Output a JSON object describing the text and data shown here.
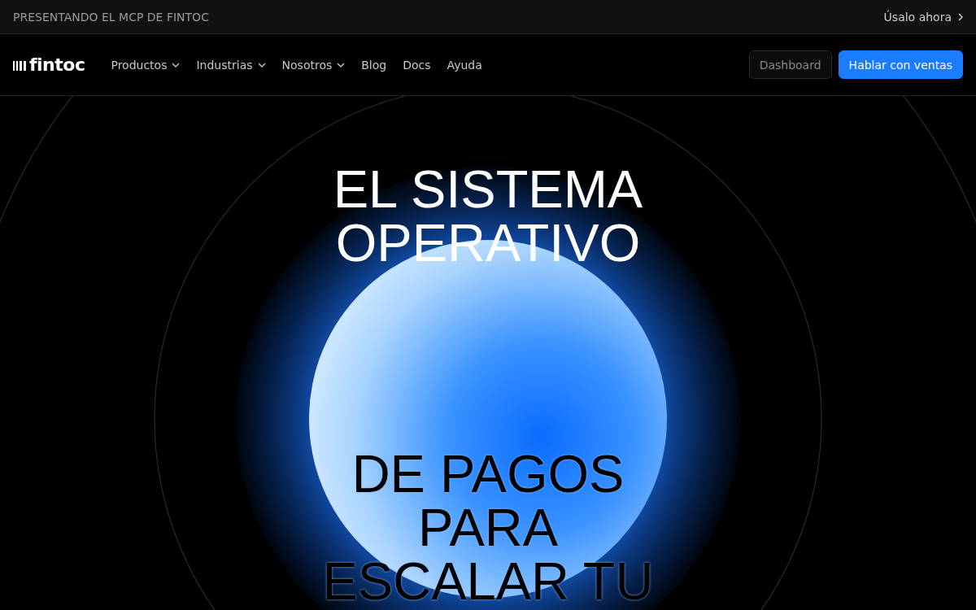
{
  "announcement": {
    "text": "PRESENTANDO EL MCP DE FINTOC",
    "link": "Úsalo ahora"
  },
  "nav": {
    "logo": "fintoc",
    "items": [
      {
        "label": "Productos",
        "kind": "dropdown"
      },
      {
        "label": "Industrias",
        "kind": "dropdown"
      },
      {
        "label": "Nosotros",
        "kind": "dropdown"
      },
      {
        "label": "Blog",
        "kind": "link"
      },
      {
        "label": "Docs",
        "kind": "link"
      },
      {
        "label": "Ayuda",
        "kind": "link"
      }
    ],
    "buttons": [
      {
        "label": "Dashboard",
        "kind": "secondary"
      },
      {
        "label": "Hablar con ventas",
        "kind": "primary"
      }
    ]
  },
  "hero": {
    "headline": [
      {
        "text": "EL SISTEMA",
        "kind": "light"
      },
      {
        "text": "OPERATIVO",
        "kind": "light"
      },
      {
        "text": "DE PAGOS",
        "kind": "dark"
      },
      {
        "text": "PARA",
        "kind": "dark"
      },
      {
        "text": "ESCALAR TU",
        "kind": "dark"
      }
    ]
  }
}
